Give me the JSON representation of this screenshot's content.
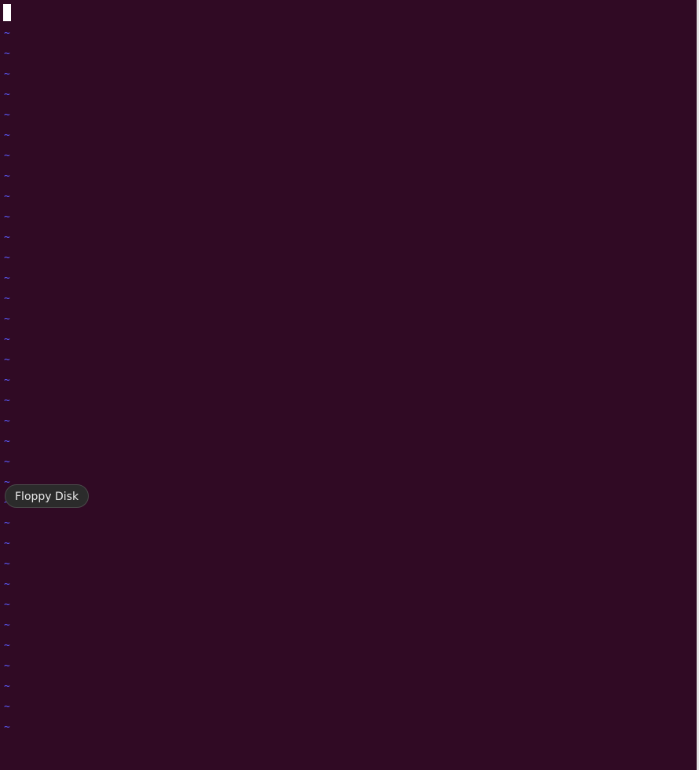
{
  "editor": {
    "empty_line_marker": "~",
    "empty_line_count": 35,
    "colors": {
      "background": "#300a24",
      "tilde": "#5c5cff",
      "cursor": "#ffffff"
    }
  },
  "tooltip": {
    "label": "Floppy Disk"
  }
}
